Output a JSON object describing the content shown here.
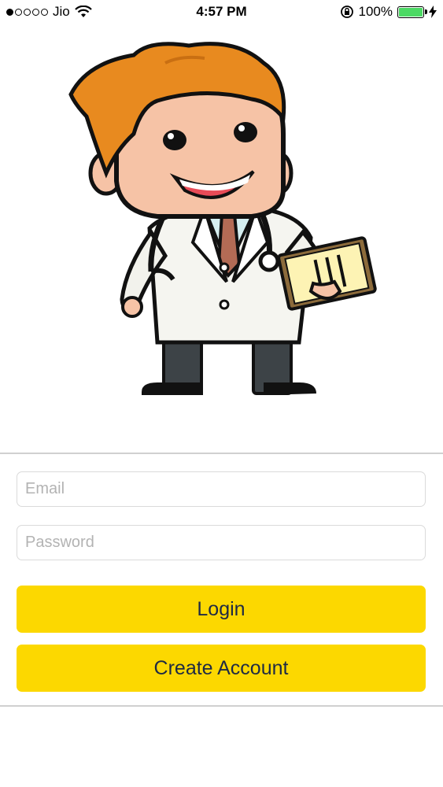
{
  "status_bar": {
    "carrier": "Jio",
    "signal_dots_filled": 1,
    "signal_dots_total": 5,
    "time": "4:57 PM",
    "battery_percent": "100%",
    "battery_level": 1.0,
    "battery_color": "#4cd964"
  },
  "illustration": {
    "subject": "cartoon doctor with stethoscope and clipboard"
  },
  "login_form": {
    "email_placeholder": "Email",
    "email_value": "",
    "password_placeholder": "Password",
    "password_value": "",
    "login_label": "Login",
    "create_account_label": "Create Account"
  },
  "colors": {
    "accent": "#fcd800",
    "button_text": "#1e2a44",
    "divider": "#d0d0d0"
  }
}
